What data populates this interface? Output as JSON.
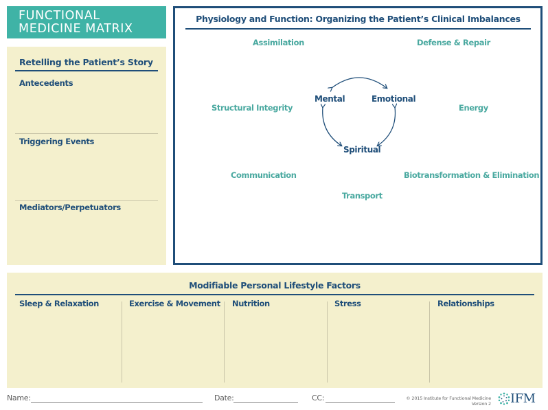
{
  "title": {
    "line1": "FUNCTIONAL",
    "line2": "MEDICINE MATRIX",
    "background_color": "#3fb3a6"
  },
  "story": {
    "title": "Retelling the Patient’s Story",
    "sections": [
      {
        "label": "Antecedents"
      },
      {
        "label": "Triggering Events"
      },
      {
        "label": "Mediators/Perpetuators"
      }
    ]
  },
  "physiology": {
    "title": "Physiology and Function: Organizing the Patient’s Clinical Imbalances",
    "systems": {
      "assimilation": "Assimilation",
      "defense_repair": "Defense & Repair",
      "structural_integrity": "Structural Integrity",
      "energy": "Energy",
      "communication": "Communication",
      "biotransformation": "Biotransformation & Elimination",
      "transport": "Transport"
    },
    "core": {
      "mental": "Mental",
      "emotional": "Emotional",
      "spiritual": "Spiritual"
    }
  },
  "lifestyle": {
    "title": "Modifiable Personal Lifestyle Factors",
    "columns": [
      {
        "label": "Sleep & Relaxation"
      },
      {
        "label": "Exercise & Movement"
      },
      {
        "label": "Nutrition"
      },
      {
        "label": "Stress"
      },
      {
        "label": "Relationships"
      }
    ]
  },
  "footer": {
    "name_label": "Name:",
    "name_value": "",
    "date_label": "Date:",
    "date_value": "",
    "cc_label": "CC:",
    "cc_value": "",
    "copyright": "© 2015 Institute for Functional Medicine",
    "version": "Version 2",
    "logo_text": "IFM",
    "logo_icon": "dotted-circle-icon"
  },
  "colors": {
    "navy": "#1f4e79",
    "teal": "#3fb3a6",
    "teal_text": "#4aa9a0",
    "beige": "#f4f0cd"
  }
}
